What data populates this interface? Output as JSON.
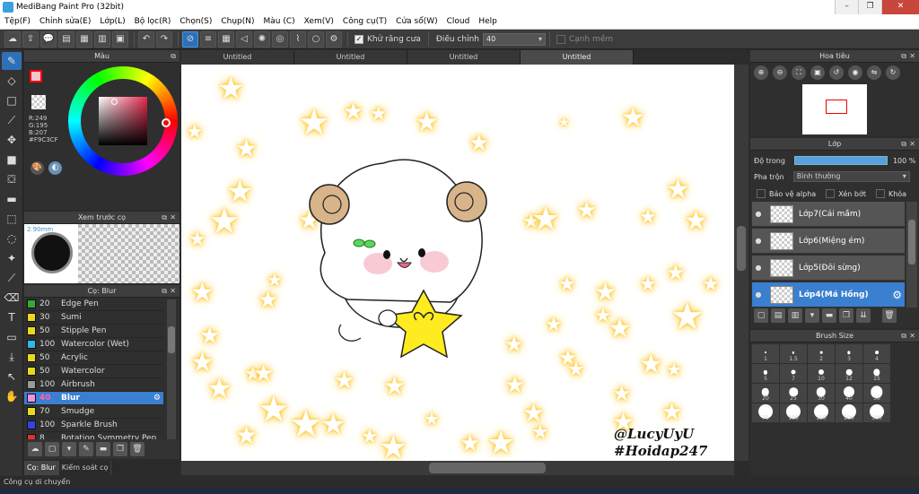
{
  "window": {
    "title": "MediBang Paint Pro (32bit)",
    "min": "–",
    "max": "❐",
    "close": "✕"
  },
  "menu": [
    "Tệp(F)",
    "Chỉnh sửa(E)",
    "Lớp(L)",
    "Bộ lọc(R)",
    "Chọn(S)",
    "Chụp(N)",
    "Màu (C)",
    "Xem(V)",
    "Công cụ(T)",
    "Cửa sổ(W)",
    "Cloud",
    "Help"
  ],
  "toolbar": {
    "antialias_label": "Khử răng cưa",
    "correction_label": "Điều chỉnh",
    "correction_value": "40",
    "snap_label": "Cạnh mềm"
  },
  "color_panel": {
    "title": "Màu",
    "r": "R:249",
    "g": "G:195",
    "b": "B:207",
    "hex": "#F9C3CF",
    "fg_color": "#F9C3CF"
  },
  "brush_preview": {
    "title": "Xem trước cọ",
    "size": "2.90mm"
  },
  "brush_panel": {
    "title": "Cọ: Blur",
    "items": [
      {
        "num": "20",
        "name": "Edge Pen",
        "color": "#33aa33"
      },
      {
        "num": "30",
        "name": "Sumi",
        "color": "#e8d820"
      },
      {
        "num": "50",
        "name": "Stipple Pen",
        "color": "#e8d820"
      },
      {
        "num": "100",
        "name": "Watercolor (Wet)",
        "color": "#30b8e8"
      },
      {
        "num": "50",
        "name": "Acrylic",
        "color": "#e8d820"
      },
      {
        "num": "50",
        "name": "Watercolor",
        "color": "#e8d820"
      },
      {
        "num": "100",
        "name": "Airbrush",
        "color": "#999999"
      },
      {
        "num": "40",
        "name": "Blur",
        "color": "#f090e0"
      },
      {
        "num": "70",
        "name": "Smudge",
        "color": "#e8d820"
      },
      {
        "num": "100",
        "name": "Sparkle Brush",
        "color": "#3344dd"
      },
      {
        "num": "8",
        "name": "Rotation Symmetry Pen",
        "color": "#e03030"
      }
    ]
  },
  "bottom_tabs": [
    "Cọ: Blur",
    "Kiểm soát cọ"
  ],
  "doc_tabs": [
    "Untitled",
    "Untitled",
    "Untitled",
    "Untitled"
  ],
  "watermark": {
    "line1": "@LucyUyU",
    "line2": "#Hoidap247"
  },
  "navigator": {
    "title": "Hoa tiêu"
  },
  "layers": {
    "title": "Lớp",
    "opacity_label": "Độ trong",
    "opacity_value": "100 %",
    "opacity": 1.0,
    "blend_label": "Pha trộn",
    "blend_value": "Bình thường",
    "protect_alpha": "Bảo vệ alpha",
    "clip": "Xén bớt",
    "lock": "Khóa",
    "items": [
      "Lớp7(Cái mầm)",
      "Lớp6(Miệng ém)",
      "Lớp5(Đôi sừng)",
      "Lớp4(Má Hồng)"
    ]
  },
  "brush_size": {
    "title": "Brush Size",
    "sizes": [
      "1",
      "1.5",
      "2",
      "3",
      "4",
      "5",
      "7",
      "10",
      "12",
      "15",
      "20",
      "25",
      "30",
      "40",
      "50",
      "70",
      "100",
      "150",
      "200",
      "300"
    ]
  },
  "status": "Công cụ di chuyển"
}
